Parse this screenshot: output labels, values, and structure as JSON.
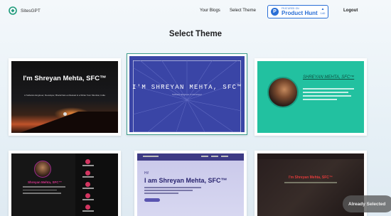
{
  "header": {
    "brand": "SitesGPT",
    "nav_blogs": "Your Blogs",
    "nav_theme": "Select Theme",
    "logout": "Logout",
    "product_hunt": {
      "featured": "FEATURED ON",
      "name": "Product Hunt",
      "icon_letter": "P",
      "count": "140"
    }
  },
  "title": "Select Theme",
  "themes": [
    {
      "name": "I'm Shreyan Mehta, SFC™",
      "tagline": "A Software Engineer, Developer, Blockchain enthusiast & a Writer from Mumbai, India"
    },
    {
      "name": "I'M SHREYAN MEHTA, SFC™",
      "tagline": "Software Engineer & Developer"
    },
    {
      "name": "SHREYAN MEHTA, SFC™"
    },
    {
      "name": "Shreyan Mehta, SFC™"
    },
    {
      "greeting": "Hi!",
      "name": "I am Shreyan Mehta, SFC™"
    },
    {
      "name": "I'm Shreyan Mehta, SFC™"
    }
  ],
  "toast": "Already Selected",
  "colors": {
    "accent": "#2a6fd6",
    "selected_border": "#3d9c8c"
  }
}
